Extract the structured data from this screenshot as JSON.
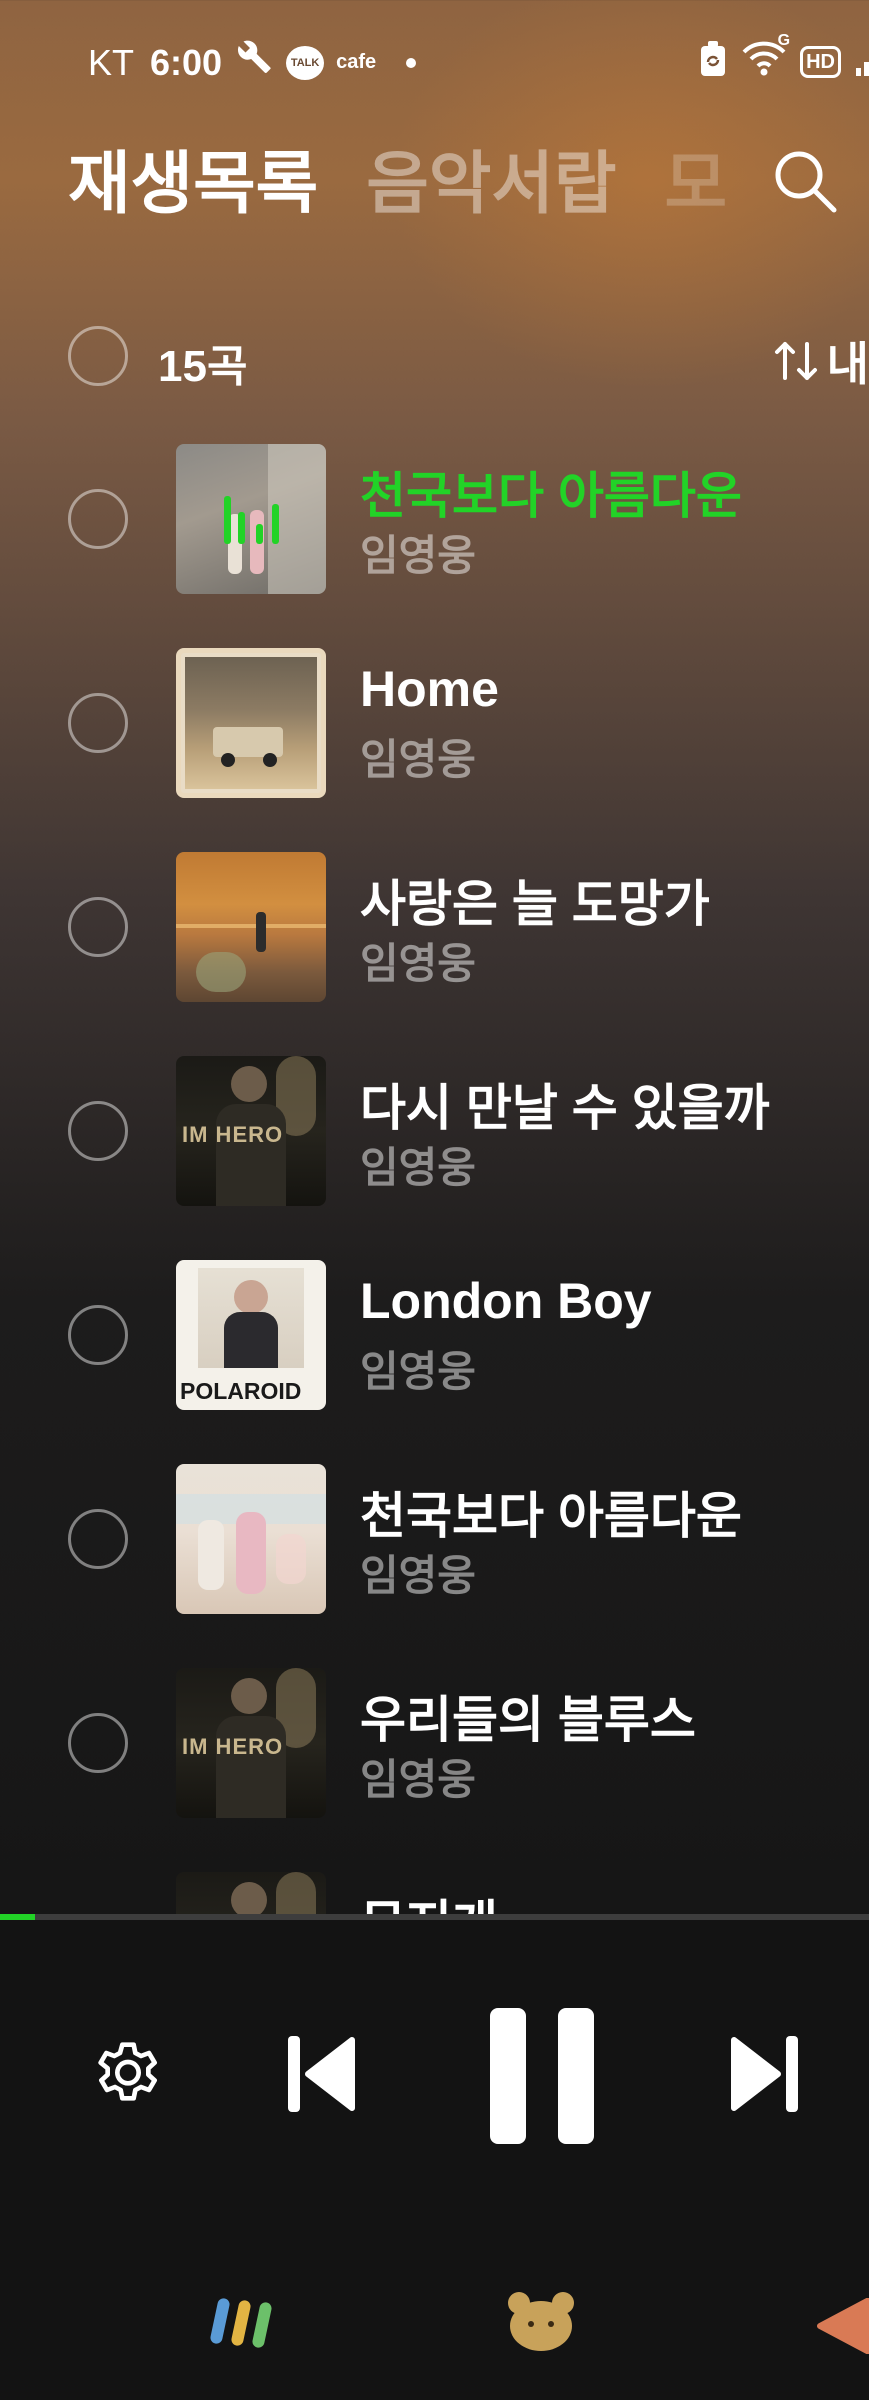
{
  "status_bar": {
    "carrier": "KT",
    "time": "6:00",
    "talk_badge": "TALK",
    "cafe_label": "cafe",
    "hd_label": "HD",
    "network_label": "G"
  },
  "tabs": [
    {
      "label": "재생목록",
      "active": true
    },
    {
      "label": "음악서랍",
      "active": false
    },
    {
      "label": "모",
      "active": false
    }
  ],
  "list_header": {
    "count": "15곡",
    "sort_label": "내"
  },
  "songs": [
    {
      "title": "천국보다 아름다운",
      "artist": "임영웅",
      "playing": true
    },
    {
      "title": "Home",
      "artist": "임영웅",
      "playing": false
    },
    {
      "title": "사랑은 늘 도망가",
      "artist": "임영웅",
      "playing": false
    },
    {
      "title": "다시 만날 수 있을까",
      "artist": "임영웅",
      "playing": false
    },
    {
      "title": "London Boy",
      "artist": "임영웅",
      "playing": false
    },
    {
      "title": "천국보다 아름다운",
      "artist": "임영웅",
      "playing": false
    },
    {
      "title": "우리들의 블루스",
      "artist": "임영웅",
      "playing": false
    },
    {
      "title": "무지개",
      "artist": "",
      "playing": false
    }
  ],
  "album_art_text": {
    "im_hero": "IM HERO",
    "polaroid": "POLAROID"
  },
  "player": {
    "progress": 0.04,
    "state": "playing"
  },
  "icons": {
    "search": "search-icon",
    "sort": "sort-icon",
    "settings": "gear-icon",
    "previous": "skip-previous-icon",
    "pause": "pause-icon",
    "next": "skip-next-icon",
    "equalizer": "equalizer-icon",
    "nav_music": "music-bars-icon",
    "nav_bear": "bear-icon",
    "nav_next": "triangle-icon"
  },
  "colors": {
    "accent_green": "#22d327",
    "background_top": "#9a6a40",
    "background_bottom": "#141414"
  }
}
